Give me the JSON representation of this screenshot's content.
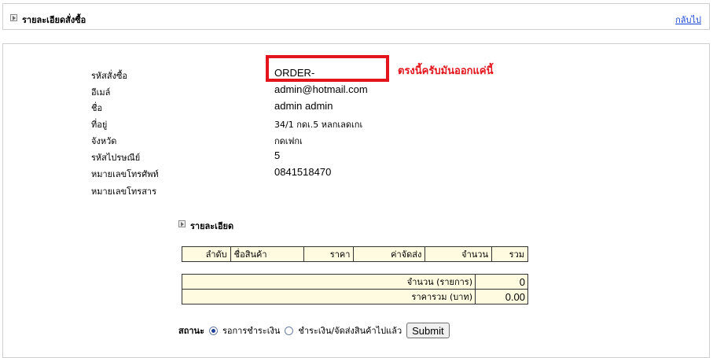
{
  "header": {
    "title": "รายละเอียดสั่งซื้อ",
    "back_link": "กลับไป"
  },
  "order": {
    "fields": [
      {
        "label": "รหัสสั่งซื้อ",
        "value": "ORDER-"
      },
      {
        "label": "อีเมล์",
        "value": "admin@hotmail.com"
      },
      {
        "label": "ชื่อ",
        "value": "admin admin"
      },
      {
        "label": "ที่อยู่",
        "value": "34/1 กดเ.5 หลกเลดเกเ"
      },
      {
        "label": "จังหวัด",
        "value": "กดเฟกเ"
      },
      {
        "label": "รหัสไปรษณีย์",
        "value": "5"
      },
      {
        "label": "หมายเลขโทรศัพท์",
        "value": "0841518470"
      },
      {
        "label": "หมายเลขโทรสาร",
        "value": ""
      }
    ],
    "annotation": "ตรงนี้ครับมันออกแค่นี้",
    "highlight_color": "#e3141b"
  },
  "details": {
    "title": "รายละเอียด",
    "columns": [
      "ลำดับ",
      "ชื่อสินค้า",
      "ราคา",
      "ค่าจัดส่ง",
      "จำนวน",
      "รวม"
    ],
    "summary": [
      {
        "label": "จำนวน (รายการ)",
        "value": "0"
      },
      {
        "label": "ราคารวม (บาท)",
        "value": "0.00"
      }
    ]
  },
  "status": {
    "label": "สถานะ",
    "options": [
      {
        "label": "รอการชำระเงิน",
        "checked": true
      },
      {
        "label": "ชำระเงิน/จัดส่งสินค้าไปแล้ว",
        "checked": false
      }
    ],
    "submit_label": "Submit"
  }
}
